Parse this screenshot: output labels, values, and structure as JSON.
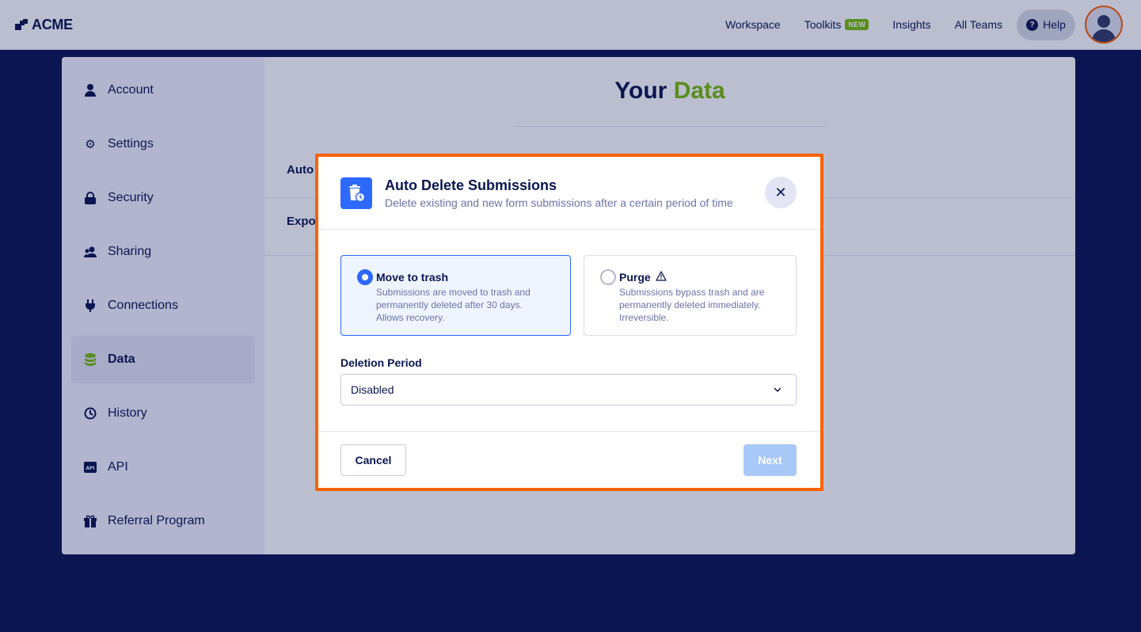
{
  "brand": {
    "logo_text": "ACME"
  },
  "topnav": {
    "items": [
      {
        "label": "Workspace"
      },
      {
        "label": "Toolkits",
        "badge": "NEW"
      },
      {
        "label": "Insights"
      },
      {
        "label": "All Teams"
      }
    ],
    "help_label": "Help"
  },
  "sidebar": {
    "items": [
      {
        "label": "Account",
        "icon": "user-icon"
      },
      {
        "label": "Settings",
        "icon": "gear-icon"
      },
      {
        "label": "Security",
        "icon": "lock-icon"
      },
      {
        "label": "Sharing",
        "icon": "users-icon"
      },
      {
        "label": "Connections",
        "icon": "plug-icon"
      },
      {
        "label": "Data",
        "icon": "database-icon",
        "active": true
      },
      {
        "label": "History",
        "icon": "history-icon"
      },
      {
        "label": "API",
        "icon": "api-icon"
      },
      {
        "label": "Referral Program",
        "icon": "gift-icon"
      }
    ]
  },
  "page": {
    "title_part1": "Your",
    "title_part2": "Data",
    "rows": [
      {
        "label": "Auto"
      },
      {
        "label": "Expo"
      }
    ]
  },
  "modal": {
    "title": "Auto Delete Submissions",
    "subtitle": "Delete existing and new form submissions after a certain period of time",
    "options": [
      {
        "title": "Move to trash",
        "description": "Submissions are moved to trash and permanently deleted after 30 days. Allows recovery.",
        "selected": true
      },
      {
        "title": "Purge",
        "description": "Submissions bypass trash and are permanently deleted immediately. Irreversible.",
        "selected": false,
        "icon": "warning-icon"
      }
    ],
    "deletion_period": {
      "label": "Deletion Period",
      "value": "Disabled"
    },
    "cancel_label": "Cancel",
    "next_label": "Next"
  },
  "colors": {
    "brand_navy": "#0a1551",
    "accent_green": "#78bb07",
    "primary_blue": "#2e69ff",
    "highlight_orange": "#ff6100",
    "disabled_blue": "#a8c8f8"
  }
}
